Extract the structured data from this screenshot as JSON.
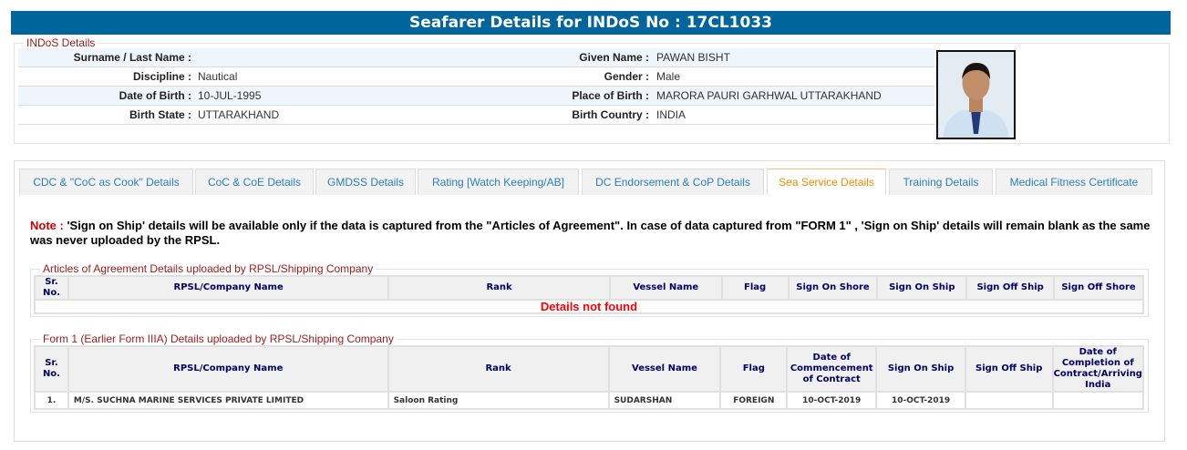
{
  "header": {
    "title": "Seafarer Details for INDoS No : 17CL1033"
  },
  "indos": {
    "legend": "INDoS Details",
    "rows": [
      {
        "l1": "Surname / Last Name :",
        "v1": "",
        "l2": "Given Name :",
        "v2": "PAWAN BISHT"
      },
      {
        "l1": "Discipline :",
        "v1": "Nautical",
        "l2": "Gender :",
        "v2": "Male"
      },
      {
        "l1": "Date of Birth :",
        "v1": "10-JUL-1995",
        "l2": "Place of Birth :",
        "v2": "MARORA PAURI GARHWAL UTTARAKHAND"
      },
      {
        "l1": "Birth State :",
        "v1": "UTTARAKHAND",
        "l2": "Birth Country :",
        "v2": "INDIA"
      }
    ]
  },
  "tabs": [
    {
      "label": "CDC & \"CoC as Cook\" Details"
    },
    {
      "label": "CoC & CoE Details"
    },
    {
      "label": "GMDSS Details"
    },
    {
      "label": "Rating [Watch Keeping/AB]"
    },
    {
      "label": "DC Endorsement & CoP Details"
    },
    {
      "label": "Sea Service Details",
      "active": true
    },
    {
      "label": "Training Details"
    },
    {
      "label": "Medical Fitness Certificate"
    }
  ],
  "note": {
    "prefix": "Note :",
    "text": " 'Sign on Ship' details will be available only if the data is captured from the \"Articles of Agreement\". In case of data captured from \"FORM 1\" , 'Sign on Ship' details will remain blank as the same was never uploaded by the RPSL."
  },
  "aoa": {
    "legend": "Articles of Agreement Details uploaded by RPSL/Shipping Company",
    "headers": [
      "Sr. No.",
      "RPSL/Company Name",
      "Rank",
      "Vessel Name",
      "Flag",
      "Sign On Shore",
      "Sign On Ship",
      "Sign Off Ship",
      "Sign Off Shore"
    ],
    "empty": "Details not found"
  },
  "form1": {
    "legend": "Form 1 (Earlier Form IIIA) Details uploaded by RPSL/Shipping Company",
    "headers": [
      "Sr. No.",
      "RPSL/Company Name",
      "Rank",
      "Vessel Name",
      "Flag",
      "Date of Commencement of Contract",
      "Sign On Ship",
      "Sign Off Ship",
      "Date of Completion of Contract/Arriving India"
    ],
    "rows": [
      [
        "1.",
        "M/S. SUCHNA MARINE SERVICES PRIVATE LIMITED",
        "Saloon Rating",
        "SUDARSHAN",
        "FOREIGN",
        "10-OCT-2019",
        "10-OCT-2019",
        "",
        ""
      ]
    ]
  },
  "colors": {
    "header": "#00659a",
    "legend": "#a01c1c",
    "active_tab": "#f08c00",
    "tab_text": "#2a7fbf",
    "error": "#ff0000"
  }
}
